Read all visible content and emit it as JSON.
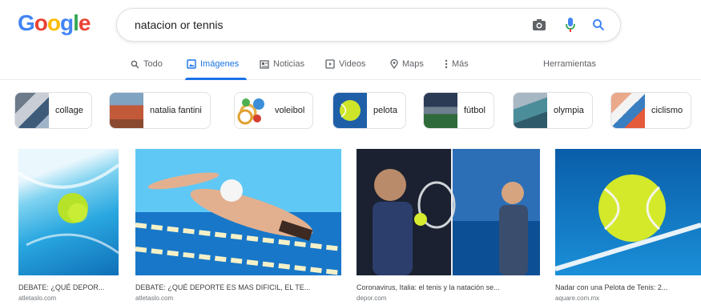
{
  "logo": {
    "letters": [
      "G",
      "o",
      "o",
      "g",
      "l",
      "e"
    ],
    "colors": [
      "#4285f4",
      "#ea4335",
      "#fbbc05",
      "#4285f4",
      "#34a853",
      "#ea4335"
    ]
  },
  "search": {
    "query": "natacion or tennis",
    "camera_icon": "camera-icon",
    "mic_icon": "mic-icon",
    "search_icon": "search-icon"
  },
  "tabs": [
    {
      "label": "Todo",
      "icon": "search-icon"
    },
    {
      "label": "Imágenes",
      "icon": "image-icon"
    },
    {
      "label": "Noticias",
      "icon": "news-icon"
    },
    {
      "label": "Videos",
      "icon": "video-icon"
    },
    {
      "label": "Maps",
      "icon": "map-pin-icon"
    },
    {
      "label": "Más",
      "icon": "more-icon"
    }
  ],
  "tools_label": "Herramientas",
  "accent_color": "#1a73e8",
  "chips": [
    {
      "label": "collage"
    },
    {
      "label": "natalia fantini"
    },
    {
      "label": "voleibol"
    },
    {
      "label": "pelota"
    },
    {
      "label": "fútbol"
    },
    {
      "label": "olympia"
    },
    {
      "label": "ciclismo"
    }
  ],
  "results": [
    {
      "caption": "DEBATE: ¿QUÉ DEPOR...",
      "source": "atletaslo.com"
    },
    {
      "caption": "DEBATE: ¿QUÉ DEPORTE ES MAS DIFICIL, EL TE...",
      "source": "atletaslo.com"
    },
    {
      "caption": "Coronavirus, Italia: el tenis y la natación se...",
      "source": "depor.com"
    },
    {
      "caption": "Nadar con una Pelota de Tenis: 2...",
      "source": "aquare.com.mx"
    }
  ]
}
